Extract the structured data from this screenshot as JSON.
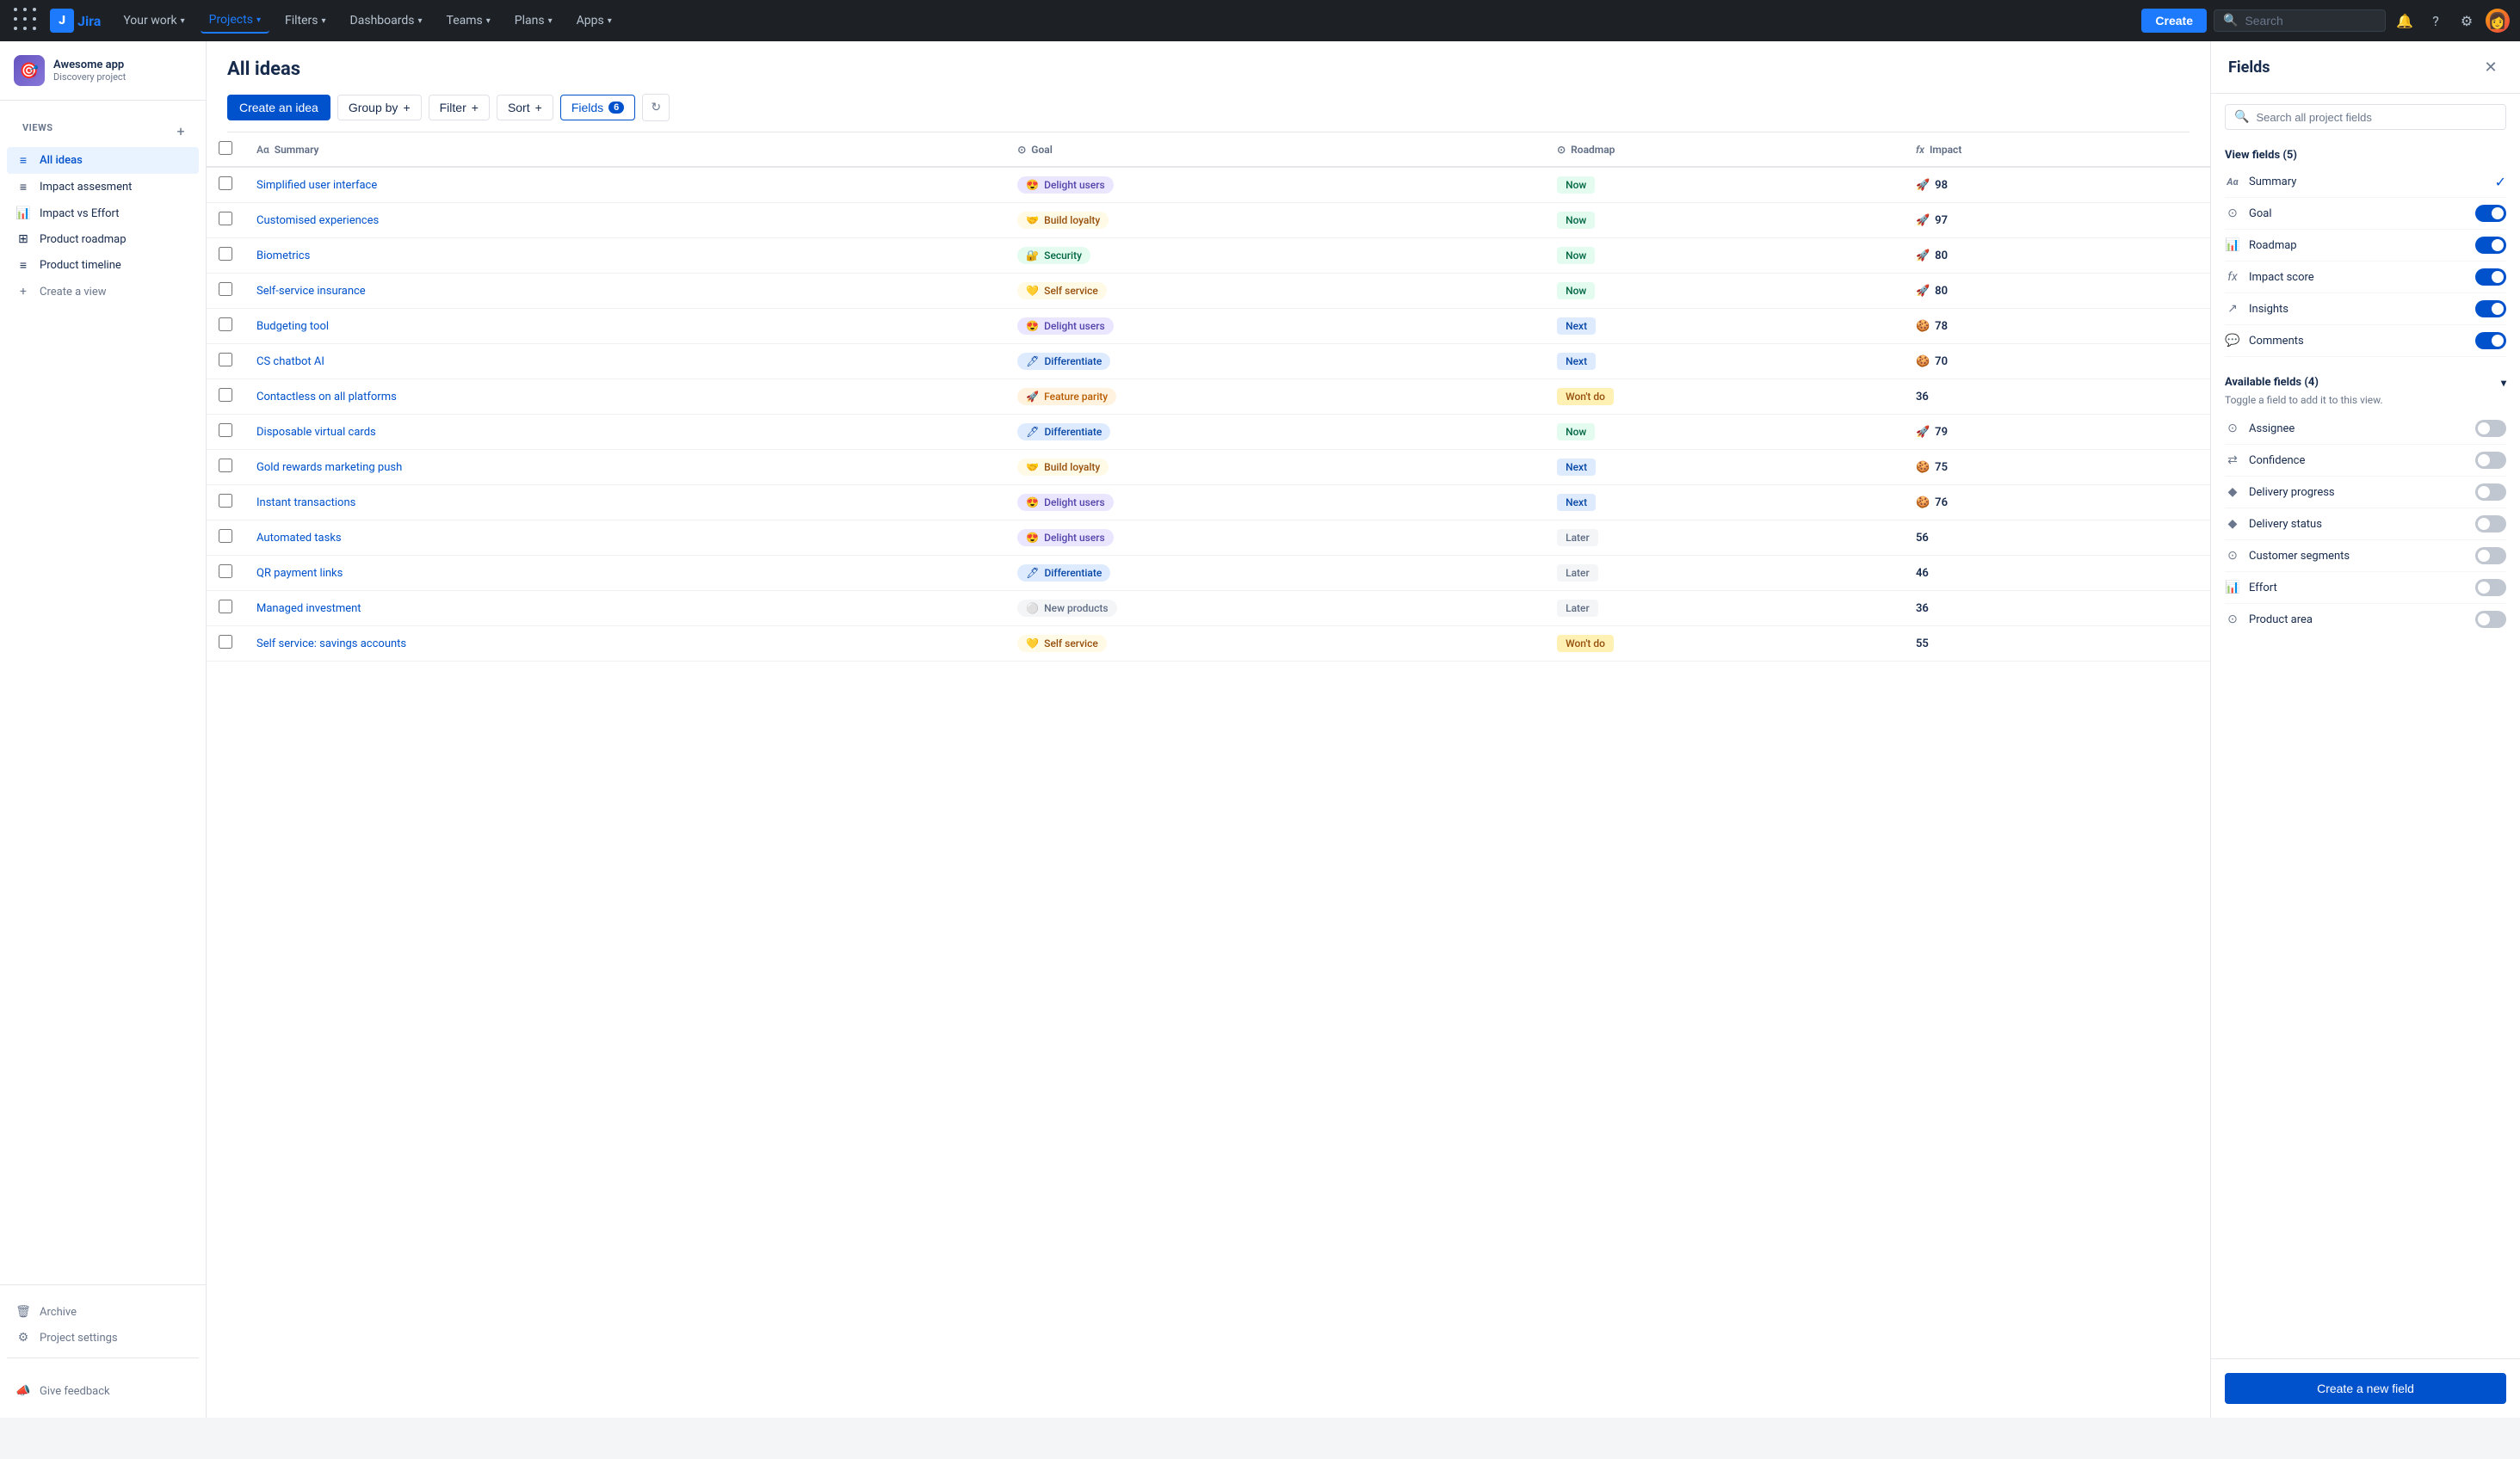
{
  "nav": {
    "items": [
      {
        "label": "Your work",
        "active": false,
        "hasChevron": true
      },
      {
        "label": "Projects",
        "active": true,
        "hasChevron": true
      },
      {
        "label": "Filters",
        "active": false,
        "hasChevron": true
      },
      {
        "label": "Dashboards",
        "active": false,
        "hasChevron": true
      },
      {
        "label": "Teams",
        "active": false,
        "hasChevron": true
      },
      {
        "label": "Plans",
        "active": false,
        "hasChevron": true
      },
      {
        "label": "Apps",
        "active": false,
        "hasChevron": true
      }
    ],
    "create_label": "Create",
    "search_placeholder": "Search"
  },
  "project": {
    "name": "Awesome app",
    "type": "Discovery project",
    "icon": "🎯"
  },
  "sidebar": {
    "views_label": "VIEWS",
    "items": [
      {
        "label": "All ideas",
        "icon": "≡",
        "active": true
      },
      {
        "label": "Impact assesment",
        "icon": "≡",
        "active": false
      },
      {
        "label": "Impact vs Effort",
        "icon": "📊",
        "active": false
      },
      {
        "label": "Product roadmap",
        "icon": "⊞",
        "active": false
      },
      {
        "label": "Product timeline",
        "icon": "≡",
        "active": false
      },
      {
        "label": "Create a view",
        "icon": "+",
        "active": false
      }
    ],
    "footer_items": [
      {
        "label": "Archive",
        "icon": "🗑"
      },
      {
        "label": "Project settings",
        "icon": "⚙"
      }
    ],
    "give_feedback": "Give feedback"
  },
  "main": {
    "title": "All ideas",
    "toolbar": {
      "create_idea": "Create an idea",
      "group_by": "Group by",
      "filter": "Filter",
      "sort": "Sort",
      "fields": "Fields",
      "fields_count": "6"
    },
    "table": {
      "columns": [
        {
          "label": "Summary",
          "icon": "Aα"
        },
        {
          "label": "Goal",
          "icon": "⊙"
        },
        {
          "label": "Roadmap",
          "icon": "⊙"
        },
        {
          "label": "Impact",
          "icon": "fx"
        }
      ],
      "rows": [
        {
          "summary": "Simplified user interface",
          "goal_emoji": "😍",
          "goal_label": "Delight users",
          "goal_color": "purple",
          "roadmap": "Now",
          "roadmap_color": "now",
          "score": 98,
          "score_emoji": "🚀"
        },
        {
          "summary": "Customised experiences",
          "goal_emoji": "🤝",
          "goal_label": "Build loyalty",
          "goal_color": "yellow",
          "roadmap": "Now",
          "roadmap_color": "now",
          "score": 97,
          "score_emoji": "🚀"
        },
        {
          "summary": "Biometrics",
          "goal_emoji": "🔐",
          "goal_label": "Security",
          "goal_color": "green",
          "roadmap": "Now",
          "roadmap_color": "now",
          "score": 80,
          "score_emoji": "🚀"
        },
        {
          "summary": "Self-service insurance",
          "goal_emoji": "💛",
          "goal_label": "Self service",
          "goal_color": "yellow",
          "roadmap": "Now",
          "roadmap_color": "now",
          "score": 80,
          "score_emoji": "🚀"
        },
        {
          "summary": "Budgeting tool",
          "goal_emoji": "😍",
          "goal_label": "Delight users",
          "goal_color": "purple",
          "roadmap": "Next",
          "roadmap_color": "next",
          "score": 78,
          "score_emoji": "🍪"
        },
        {
          "summary": "CS chatbot AI",
          "goal_emoji": "🖊",
          "goal_label": "Differentiate",
          "goal_color": "blue",
          "roadmap": "Next",
          "roadmap_color": "next",
          "score": 70,
          "score_emoji": "🍪"
        },
        {
          "summary": "Contactless on all platforms",
          "goal_emoji": "🚀",
          "goal_label": "Feature parity",
          "goal_color": "orange",
          "roadmap": "Won't do",
          "roadmap_color": "wontdo",
          "score": 36,
          "score_emoji": ""
        },
        {
          "summary": "Disposable virtual cards",
          "goal_emoji": "🖊",
          "goal_label": "Differentiate",
          "goal_color": "blue",
          "roadmap": "Now",
          "roadmap_color": "now",
          "score": 79,
          "score_emoji": "🚀"
        },
        {
          "summary": "Gold rewards marketing push",
          "goal_emoji": "🤝",
          "goal_label": "Build loyalty",
          "goal_color": "yellow",
          "roadmap": "Next",
          "roadmap_color": "next",
          "score": 75,
          "score_emoji": "🍪"
        },
        {
          "summary": "Instant transactions",
          "goal_emoji": "😍",
          "goal_label": "Delight users",
          "goal_color": "purple",
          "roadmap": "Next",
          "roadmap_color": "next",
          "score": 76,
          "score_emoji": "🍪"
        },
        {
          "summary": "Automated tasks",
          "goal_emoji": "😍",
          "goal_label": "Delight users",
          "goal_color": "purple",
          "roadmap": "Later",
          "roadmap_color": "later",
          "score": 56,
          "score_emoji": ""
        },
        {
          "summary": "QR payment links",
          "goal_emoji": "🖊",
          "goal_label": "Differentiate",
          "goal_color": "blue",
          "roadmap": "Later",
          "roadmap_color": "later",
          "score": 46,
          "score_emoji": ""
        },
        {
          "summary": "Managed investment",
          "goal_emoji": "⚪",
          "goal_label": "New products",
          "goal_color": "grey",
          "roadmap": "Later",
          "roadmap_color": "later",
          "score": 36,
          "score_emoji": ""
        },
        {
          "summary": "Self service: savings accounts",
          "goal_emoji": "💛",
          "goal_label": "Self service",
          "goal_color": "yellow",
          "roadmap": "Won't do",
          "roadmap_color": "wontdo",
          "score": 55,
          "score_emoji": ""
        }
      ]
    }
  },
  "fields_panel": {
    "title": "Fields",
    "search_placeholder": "Search all project fields",
    "view_fields_title": "View fields (5)",
    "view_fields": [
      {
        "label": "Summary",
        "icon": "Aα",
        "enabled": true,
        "check": true
      },
      {
        "label": "Goal",
        "icon": "⊙",
        "enabled": true,
        "check": false
      },
      {
        "label": "Roadmap",
        "icon": "📊",
        "enabled": true,
        "check": false
      },
      {
        "label": "Impact score",
        "icon": "fx",
        "enabled": true,
        "check": false
      },
      {
        "label": "Insights",
        "icon": "↗",
        "enabled": true,
        "check": false
      },
      {
        "label": "Comments",
        "icon": "💬",
        "enabled": true,
        "check": false
      }
    ],
    "available_fields_title": "Available fields (4)",
    "available_fields_subtitle": "Toggle a field to add it to this view.",
    "available_fields": [
      {
        "label": "Assignee",
        "icon": "⊙",
        "enabled": false
      },
      {
        "label": "Confidence",
        "icon": "⇄",
        "enabled": false
      },
      {
        "label": "Delivery progress",
        "icon": "◆",
        "enabled": false
      },
      {
        "label": "Delivery status",
        "icon": "◆",
        "enabled": false
      },
      {
        "label": "Customer segments",
        "icon": "⊙",
        "enabled": false
      },
      {
        "label": "Effort",
        "icon": "📊",
        "enabled": false
      },
      {
        "label": "Product area",
        "icon": "⊙",
        "enabled": false
      }
    ],
    "create_field_label": "Create a new field"
  }
}
